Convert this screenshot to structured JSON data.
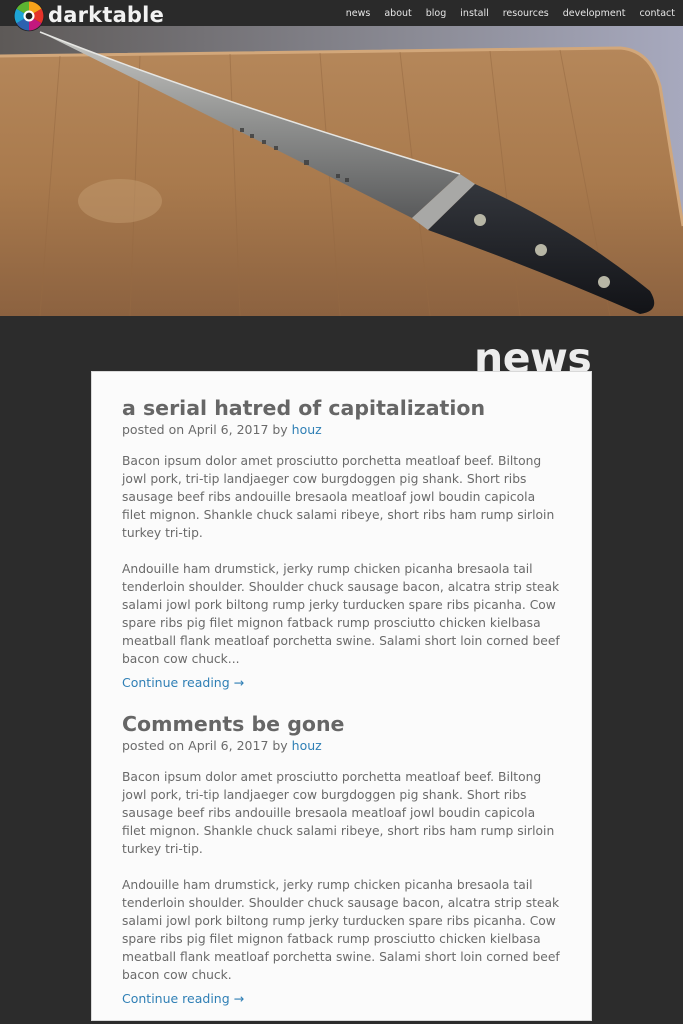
{
  "site": {
    "brand": "darktable",
    "nav": [
      "news",
      "about",
      "blog",
      "install",
      "resources",
      "development",
      "contact"
    ]
  },
  "section": {
    "title": "news"
  },
  "posts": [
    {
      "title": "a serial hatred of capitalization",
      "posted_prefix": "posted on April 6, 2017 by",
      "author": "houz",
      "paragraphs": [
        "Bacon ipsum dolor amet prosciutto porchetta meatloaf beef. Biltong jowl pork, tri-tip landjaeger cow burgdoggen pig shank. Short ribs sausage beef ribs andouille bresaola meatloaf jowl boudin capicola filet mignon. Shankle chuck salami ribeye, short ribs ham rump sirloin turkey tri-tip.",
        "Andouille ham drumstick, jerky rump chicken picanha bresaola tail tenderloin shoulder. Shoulder chuck sausage bacon, alcatra strip steak salami jowl pork biltong rump jerky turducken spare ribs picanha. Cow spare ribs pig filet mignon fatback rump prosciutto chicken kielbasa meatball flank meatloaf porchetta swine. Salami short loin corned beef bacon cow chuck..."
      ],
      "read_more": "Continue reading →"
    },
    {
      "title": "Comments be gone",
      "posted_prefix": "posted on April 6, 2017 by",
      "author": "houz",
      "paragraphs": [
        "Bacon ipsum dolor amet prosciutto porchetta meatloaf beef. Biltong jowl pork, tri-tip landjaeger cow burgdoggen pig shank. Short ribs sausage beef ribs andouille bresaola meatloaf jowl boudin capicola filet mignon. Shankle chuck salami ribeye, short ribs ham rump sirloin turkey tri-tip.",
        "Andouille ham drumstick, jerky rump chicken picanha bresaola tail tenderloin shoulder. Shoulder chuck sausage bacon, alcatra strip steak salami jowl pork biltong rump jerky turducken spare ribs picanha. Cow spare ribs pig filet mignon fatback rump prosciutto chicken kielbasa meatball flank meatloaf porchetta swine. Salami short loin corned beef bacon cow chuck."
      ],
      "read_more": "Continue reading →"
    }
  ],
  "icons": {
    "logo": "darktable-aperture-logo-icon",
    "hero": "chef-knife-on-cutting-board-photo"
  },
  "colors": {
    "page_bg": "#2c2c2c",
    "card_bg": "#fbfbfb",
    "link": "#2f7fb5",
    "heading_text": "#666666"
  }
}
